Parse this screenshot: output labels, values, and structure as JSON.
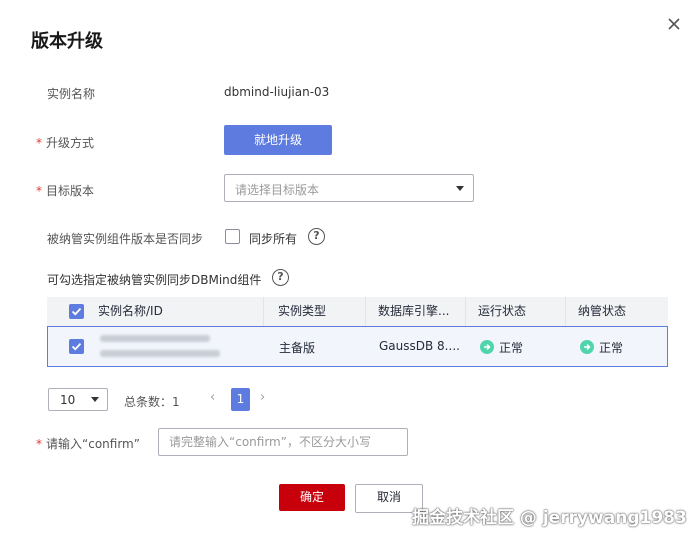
{
  "dialog": {
    "title": "版本升级"
  },
  "instance_name": {
    "label": "实例名称",
    "value": "dbmind-liujian-03"
  },
  "upgrade_method": {
    "label": "升级方式",
    "button": "就地升级"
  },
  "target_version": {
    "label": "目标版本",
    "placeholder": "请选择目标版本"
  },
  "sync_components": {
    "label": "被纳管实例组件版本是否同步",
    "checkbox_label": "同步所有",
    "help": "?"
  },
  "selectable_hint": {
    "label": "可勾选指定被纳管实例同步DBMind组件",
    "help": "?"
  },
  "table": {
    "columns": [
      "实例名称/ID",
      "实例类型",
      "数据库引擎...",
      "运行状态",
      "纳管状态"
    ],
    "rows": [
      {
        "type": "主备版",
        "engine": "GaussDB 8....",
        "run_status": "正常",
        "manage_status": "正常",
        "checked": true
      }
    ]
  },
  "pagination": {
    "page_size": "10",
    "total_label": "总条数：1",
    "current_page": "1"
  },
  "confirm": {
    "label": "请输入“confirm”",
    "placeholder": "请完整输入“confirm”，不区分大小写"
  },
  "footer": {
    "ok_label": "确定",
    "cancel_label": "取消"
  },
  "watermark": "掘金技术社区 @ jerrywang1983",
  "colors": {
    "accent": "#5e7ce0",
    "danger": "#c7000b",
    "success": "#50d4ab",
    "required_star": "#e23b3b"
  }
}
